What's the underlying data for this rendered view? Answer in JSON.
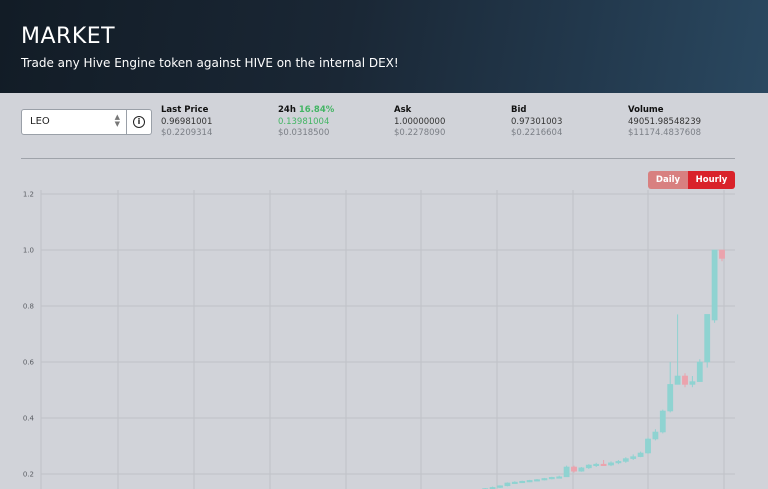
{
  "header": {
    "title": "MARKET",
    "subtitle": "Trade any Hive Engine token against HIVE on the internal DEX!"
  },
  "token_select": {
    "value": "LEO"
  },
  "stats": {
    "last_price": {
      "label": "Last Price",
      "value": "0.96981001",
      "usd": "$0.2209314"
    },
    "change_24h": {
      "label": "24h",
      "percent": "16.84%",
      "value": "0.13981004",
      "usd": "$0.0318500"
    },
    "ask": {
      "label": "Ask",
      "value": "1.00000000",
      "usd": "$0.2278090"
    },
    "bid": {
      "label": "Bid",
      "value": "0.97301003",
      "usd": "$0.2216604"
    },
    "volume": {
      "label": "Volume",
      "value": "49051.98548239",
      "usd": "$11174.4837608"
    }
  },
  "interval_toggle": {
    "daily_label": "Daily",
    "hourly_label": "Hourly",
    "selected": "Hourly"
  },
  "colors": {
    "up": "#8fd3d1",
    "down": "#eba3ad",
    "positive_text": "#43b564",
    "accent": "#d9222a"
  },
  "chart_data": {
    "type": "candlestick",
    "ylim": [
      0.14,
      1.2
    ],
    "y_ticks": [
      "0.2",
      "0.4",
      "0.6",
      "0.8",
      "1.0",
      "1.2"
    ],
    "series": [
      {
        "ohlc": [
          [
            0.145,
            0.15,
            0.143,
            0.148
          ],
          [
            0.148,
            0.155,
            0.146,
            0.152
          ],
          [
            0.152,
            0.16,
            0.15,
            0.158
          ],
          [
            0.158,
            0.17,
            0.156,
            0.168
          ],
          [
            0.168,
            0.174,
            0.165,
            0.171
          ],
          [
            0.171,
            0.176,
            0.168,
            0.174
          ],
          [
            0.174,
            0.179,
            0.171,
            0.177
          ],
          [
            0.177,
            0.182,
            0.174,
            0.18
          ],
          [
            0.18,
            0.186,
            0.177,
            0.184
          ],
          [
            0.184,
            0.19,
            0.181,
            0.188
          ],
          [
            0.188,
            0.194,
            0.185,
            0.19
          ],
          [
            0.19,
            0.23,
            0.19,
            0.225
          ],
          [
            0.225,
            0.23,
            0.205,
            0.21
          ],
          [
            0.21,
            0.225,
            0.208,
            0.222
          ],
          [
            0.222,
            0.235,
            0.218,
            0.232
          ],
          [
            0.232,
            0.24,
            0.225,
            0.235
          ],
          [
            0.235,
            0.25,
            0.23,
            0.232
          ],
          [
            0.232,
            0.245,
            0.228,
            0.24
          ],
          [
            0.24,
            0.25,
            0.235,
            0.245
          ],
          [
            0.245,
            0.26,
            0.24,
            0.255
          ],
          [
            0.255,
            0.27,
            0.25,
            0.262
          ],
          [
            0.262,
            0.28,
            0.26,
            0.275
          ],
          [
            0.275,
            0.33,
            0.272,
            0.325
          ],
          [
            0.325,
            0.36,
            0.32,
            0.35
          ],
          [
            0.35,
            0.43,
            0.345,
            0.425
          ],
          [
            0.425,
            0.6,
            0.42,
            0.52
          ],
          [
            0.52,
            0.77,
            0.52,
            0.55
          ],
          [
            0.55,
            0.56,
            0.51,
            0.52
          ],
          [
            0.52,
            0.55,
            0.51,
            0.53
          ],
          [
            0.53,
            0.61,
            0.53,
            0.6
          ],
          [
            0.6,
            0.77,
            0.58,
            0.77
          ],
          [
            0.75,
            1.0,
            0.74,
            1.0
          ],
          [
            1.0,
            1.0,
            0.96,
            0.97
          ]
        ]
      }
    ]
  }
}
